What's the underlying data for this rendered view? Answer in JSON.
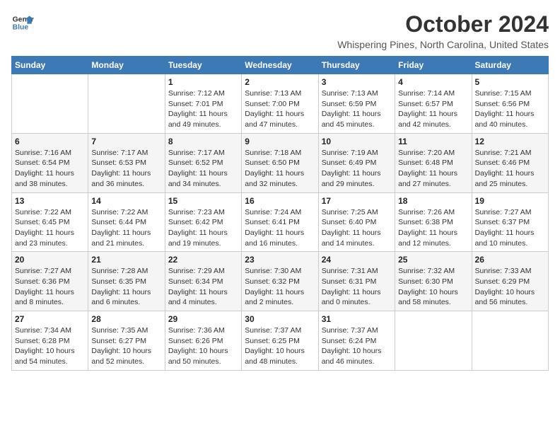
{
  "header": {
    "logo_line1": "General",
    "logo_line2": "Blue",
    "month_title": "October 2024",
    "location": "Whispering Pines, North Carolina, United States"
  },
  "weekdays": [
    "Sunday",
    "Monday",
    "Tuesday",
    "Wednesday",
    "Thursday",
    "Friday",
    "Saturday"
  ],
  "weeks": [
    [
      {
        "day": "",
        "info": ""
      },
      {
        "day": "",
        "info": ""
      },
      {
        "day": "1",
        "info": "Sunrise: 7:12 AM\nSunset: 7:01 PM\nDaylight: 11 hours and 49 minutes."
      },
      {
        "day": "2",
        "info": "Sunrise: 7:13 AM\nSunset: 7:00 PM\nDaylight: 11 hours and 47 minutes."
      },
      {
        "day": "3",
        "info": "Sunrise: 7:13 AM\nSunset: 6:59 PM\nDaylight: 11 hours and 45 minutes."
      },
      {
        "day": "4",
        "info": "Sunrise: 7:14 AM\nSunset: 6:57 PM\nDaylight: 11 hours and 42 minutes."
      },
      {
        "day": "5",
        "info": "Sunrise: 7:15 AM\nSunset: 6:56 PM\nDaylight: 11 hours and 40 minutes."
      }
    ],
    [
      {
        "day": "6",
        "info": "Sunrise: 7:16 AM\nSunset: 6:54 PM\nDaylight: 11 hours and 38 minutes."
      },
      {
        "day": "7",
        "info": "Sunrise: 7:17 AM\nSunset: 6:53 PM\nDaylight: 11 hours and 36 minutes."
      },
      {
        "day": "8",
        "info": "Sunrise: 7:17 AM\nSunset: 6:52 PM\nDaylight: 11 hours and 34 minutes."
      },
      {
        "day": "9",
        "info": "Sunrise: 7:18 AM\nSunset: 6:50 PM\nDaylight: 11 hours and 32 minutes."
      },
      {
        "day": "10",
        "info": "Sunrise: 7:19 AM\nSunset: 6:49 PM\nDaylight: 11 hours and 29 minutes."
      },
      {
        "day": "11",
        "info": "Sunrise: 7:20 AM\nSunset: 6:48 PM\nDaylight: 11 hours and 27 minutes."
      },
      {
        "day": "12",
        "info": "Sunrise: 7:21 AM\nSunset: 6:46 PM\nDaylight: 11 hours and 25 minutes."
      }
    ],
    [
      {
        "day": "13",
        "info": "Sunrise: 7:22 AM\nSunset: 6:45 PM\nDaylight: 11 hours and 23 minutes."
      },
      {
        "day": "14",
        "info": "Sunrise: 7:22 AM\nSunset: 6:44 PM\nDaylight: 11 hours and 21 minutes."
      },
      {
        "day": "15",
        "info": "Sunrise: 7:23 AM\nSunset: 6:42 PM\nDaylight: 11 hours and 19 minutes."
      },
      {
        "day": "16",
        "info": "Sunrise: 7:24 AM\nSunset: 6:41 PM\nDaylight: 11 hours and 16 minutes."
      },
      {
        "day": "17",
        "info": "Sunrise: 7:25 AM\nSunset: 6:40 PM\nDaylight: 11 hours and 14 minutes."
      },
      {
        "day": "18",
        "info": "Sunrise: 7:26 AM\nSunset: 6:38 PM\nDaylight: 11 hours and 12 minutes."
      },
      {
        "day": "19",
        "info": "Sunrise: 7:27 AM\nSunset: 6:37 PM\nDaylight: 11 hours and 10 minutes."
      }
    ],
    [
      {
        "day": "20",
        "info": "Sunrise: 7:27 AM\nSunset: 6:36 PM\nDaylight: 11 hours and 8 minutes."
      },
      {
        "day": "21",
        "info": "Sunrise: 7:28 AM\nSunset: 6:35 PM\nDaylight: 11 hours and 6 minutes."
      },
      {
        "day": "22",
        "info": "Sunrise: 7:29 AM\nSunset: 6:34 PM\nDaylight: 11 hours and 4 minutes."
      },
      {
        "day": "23",
        "info": "Sunrise: 7:30 AM\nSunset: 6:32 PM\nDaylight: 11 hours and 2 minutes."
      },
      {
        "day": "24",
        "info": "Sunrise: 7:31 AM\nSunset: 6:31 PM\nDaylight: 11 hours and 0 minutes."
      },
      {
        "day": "25",
        "info": "Sunrise: 7:32 AM\nSunset: 6:30 PM\nDaylight: 10 hours and 58 minutes."
      },
      {
        "day": "26",
        "info": "Sunrise: 7:33 AM\nSunset: 6:29 PM\nDaylight: 10 hours and 56 minutes."
      }
    ],
    [
      {
        "day": "27",
        "info": "Sunrise: 7:34 AM\nSunset: 6:28 PM\nDaylight: 10 hours and 54 minutes."
      },
      {
        "day": "28",
        "info": "Sunrise: 7:35 AM\nSunset: 6:27 PM\nDaylight: 10 hours and 52 minutes."
      },
      {
        "day": "29",
        "info": "Sunrise: 7:36 AM\nSunset: 6:26 PM\nDaylight: 10 hours and 50 minutes."
      },
      {
        "day": "30",
        "info": "Sunrise: 7:37 AM\nSunset: 6:25 PM\nDaylight: 10 hours and 48 minutes."
      },
      {
        "day": "31",
        "info": "Sunrise: 7:37 AM\nSunset: 6:24 PM\nDaylight: 10 hours and 46 minutes."
      },
      {
        "day": "",
        "info": ""
      },
      {
        "day": "",
        "info": ""
      }
    ]
  ]
}
